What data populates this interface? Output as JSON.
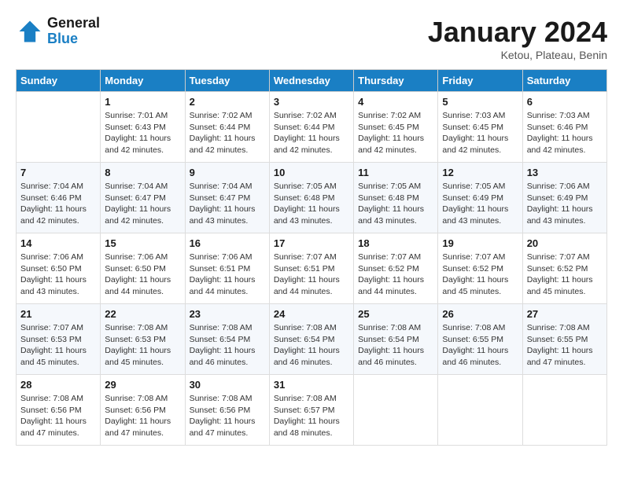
{
  "header": {
    "logo_line1": "General",
    "logo_line2": "Blue",
    "month": "January 2024",
    "location": "Ketou, Plateau, Benin"
  },
  "weekdays": [
    "Sunday",
    "Monday",
    "Tuesday",
    "Wednesday",
    "Thursday",
    "Friday",
    "Saturday"
  ],
  "weeks": [
    [
      {
        "day": "",
        "info": ""
      },
      {
        "day": "1",
        "info": "Sunrise: 7:01 AM\nSunset: 6:43 PM\nDaylight: 11 hours\nand 42 minutes."
      },
      {
        "day": "2",
        "info": "Sunrise: 7:02 AM\nSunset: 6:44 PM\nDaylight: 11 hours\nand 42 minutes."
      },
      {
        "day": "3",
        "info": "Sunrise: 7:02 AM\nSunset: 6:44 PM\nDaylight: 11 hours\nand 42 minutes."
      },
      {
        "day": "4",
        "info": "Sunrise: 7:02 AM\nSunset: 6:45 PM\nDaylight: 11 hours\nand 42 minutes."
      },
      {
        "day": "5",
        "info": "Sunrise: 7:03 AM\nSunset: 6:45 PM\nDaylight: 11 hours\nand 42 minutes."
      },
      {
        "day": "6",
        "info": "Sunrise: 7:03 AM\nSunset: 6:46 PM\nDaylight: 11 hours\nand 42 minutes."
      }
    ],
    [
      {
        "day": "7",
        "info": "Sunrise: 7:04 AM\nSunset: 6:46 PM\nDaylight: 11 hours\nand 42 minutes."
      },
      {
        "day": "8",
        "info": "Sunrise: 7:04 AM\nSunset: 6:47 PM\nDaylight: 11 hours\nand 42 minutes."
      },
      {
        "day": "9",
        "info": "Sunrise: 7:04 AM\nSunset: 6:47 PM\nDaylight: 11 hours\nand 43 minutes."
      },
      {
        "day": "10",
        "info": "Sunrise: 7:05 AM\nSunset: 6:48 PM\nDaylight: 11 hours\nand 43 minutes."
      },
      {
        "day": "11",
        "info": "Sunrise: 7:05 AM\nSunset: 6:48 PM\nDaylight: 11 hours\nand 43 minutes."
      },
      {
        "day": "12",
        "info": "Sunrise: 7:05 AM\nSunset: 6:49 PM\nDaylight: 11 hours\nand 43 minutes."
      },
      {
        "day": "13",
        "info": "Sunrise: 7:06 AM\nSunset: 6:49 PM\nDaylight: 11 hours\nand 43 minutes."
      }
    ],
    [
      {
        "day": "14",
        "info": "Sunrise: 7:06 AM\nSunset: 6:50 PM\nDaylight: 11 hours\nand 43 minutes."
      },
      {
        "day": "15",
        "info": "Sunrise: 7:06 AM\nSunset: 6:50 PM\nDaylight: 11 hours\nand 44 minutes."
      },
      {
        "day": "16",
        "info": "Sunrise: 7:06 AM\nSunset: 6:51 PM\nDaylight: 11 hours\nand 44 minutes."
      },
      {
        "day": "17",
        "info": "Sunrise: 7:07 AM\nSunset: 6:51 PM\nDaylight: 11 hours\nand 44 minutes."
      },
      {
        "day": "18",
        "info": "Sunrise: 7:07 AM\nSunset: 6:52 PM\nDaylight: 11 hours\nand 44 minutes."
      },
      {
        "day": "19",
        "info": "Sunrise: 7:07 AM\nSunset: 6:52 PM\nDaylight: 11 hours\nand 45 minutes."
      },
      {
        "day": "20",
        "info": "Sunrise: 7:07 AM\nSunset: 6:52 PM\nDaylight: 11 hours\nand 45 minutes."
      }
    ],
    [
      {
        "day": "21",
        "info": "Sunrise: 7:07 AM\nSunset: 6:53 PM\nDaylight: 11 hours\nand 45 minutes."
      },
      {
        "day": "22",
        "info": "Sunrise: 7:08 AM\nSunset: 6:53 PM\nDaylight: 11 hours\nand 45 minutes."
      },
      {
        "day": "23",
        "info": "Sunrise: 7:08 AM\nSunset: 6:54 PM\nDaylight: 11 hours\nand 46 minutes."
      },
      {
        "day": "24",
        "info": "Sunrise: 7:08 AM\nSunset: 6:54 PM\nDaylight: 11 hours\nand 46 minutes."
      },
      {
        "day": "25",
        "info": "Sunrise: 7:08 AM\nSunset: 6:54 PM\nDaylight: 11 hours\nand 46 minutes."
      },
      {
        "day": "26",
        "info": "Sunrise: 7:08 AM\nSunset: 6:55 PM\nDaylight: 11 hours\nand 46 minutes."
      },
      {
        "day": "27",
        "info": "Sunrise: 7:08 AM\nSunset: 6:55 PM\nDaylight: 11 hours\nand 47 minutes."
      }
    ],
    [
      {
        "day": "28",
        "info": "Sunrise: 7:08 AM\nSunset: 6:56 PM\nDaylight: 11 hours\nand 47 minutes."
      },
      {
        "day": "29",
        "info": "Sunrise: 7:08 AM\nSunset: 6:56 PM\nDaylight: 11 hours\nand 47 minutes."
      },
      {
        "day": "30",
        "info": "Sunrise: 7:08 AM\nSunset: 6:56 PM\nDaylight: 11 hours\nand 47 minutes."
      },
      {
        "day": "31",
        "info": "Sunrise: 7:08 AM\nSunset: 6:57 PM\nDaylight: 11 hours\nand 48 minutes."
      },
      {
        "day": "",
        "info": ""
      },
      {
        "day": "",
        "info": ""
      },
      {
        "day": "",
        "info": ""
      }
    ]
  ]
}
